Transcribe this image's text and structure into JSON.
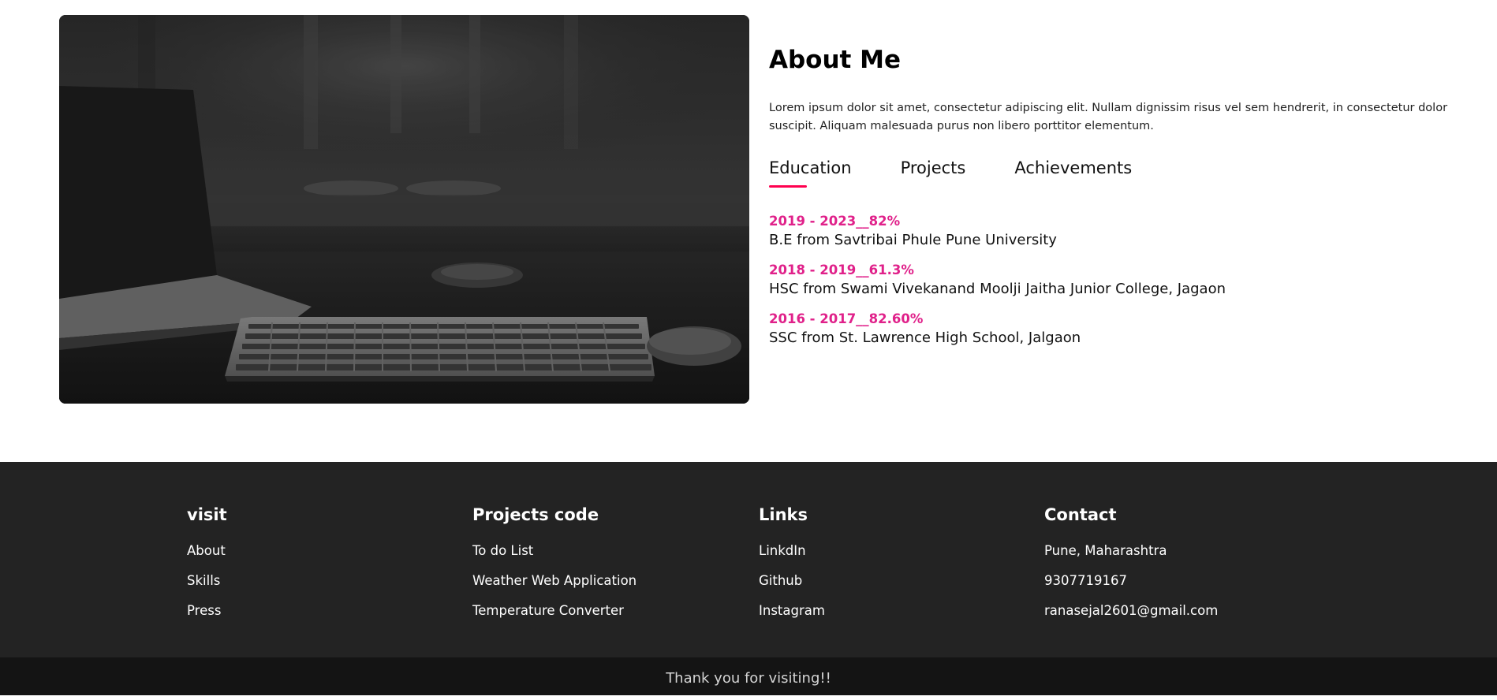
{
  "about": {
    "title": "About Me",
    "description": "Lorem ipsum dolor sit amet, consectetur adipiscing elit. Nullam dignissim risus vel sem hendrerit, in consectetur dolor suscipit. Aliquam malesuada purus non libero porttitor elementum.",
    "tabs": [
      {
        "label": "Education",
        "active": true
      },
      {
        "label": "Projects",
        "active": false
      },
      {
        "label": "Achievements",
        "active": false
      }
    ],
    "education": [
      {
        "year": "2019 - 2023__82%",
        "detail": "B.E from Savtribai Phule Pune University"
      },
      {
        "year": "2018 - 2019__61.3%",
        "detail": "HSC from Swami Vivekanand Moolji Jaitha Junior College, Jagaon"
      },
      {
        "year": "2016 - 2017__82.60%",
        "detail": "SSC from St. Lawrence High School, Jalgaon"
      }
    ],
    "accent_color": "#e0218a",
    "tab_underline_color": "#ff004f"
  },
  "footer": {
    "columns": [
      {
        "heading": "visit",
        "links": [
          "About",
          "Skills",
          "Press"
        ]
      },
      {
        "heading": "Projects code",
        "links": [
          "To do List",
          "Weather Web Application",
          "Temperature Converter"
        ]
      },
      {
        "heading": "Links",
        "links": [
          "LinkdIn",
          "Github",
          "Instagram"
        ]
      },
      {
        "heading": "Contact",
        "links": [
          "Pune, Maharashtra",
          "9307719167",
          "ranasejal2601@gmail.com"
        ]
      }
    ],
    "background_color": "#232323"
  },
  "copyright": {
    "text": "Thank you for visiting!!"
  }
}
